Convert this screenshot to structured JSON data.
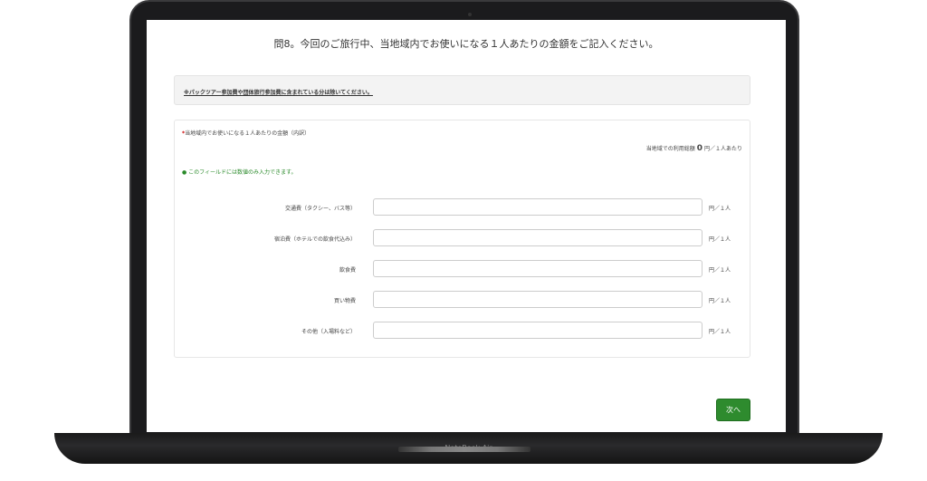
{
  "device": {
    "label": "NoteBook Air"
  },
  "page": {
    "title": "問8。今回のご旅行中、当地域内でお使いになる１人あたりの金額をご記入ください。",
    "notice": "※パックツアー参加費や団体旅行参加費に含まれている分は除いてください。",
    "question_label": "当地域内でお使いになる１人あたりの金額（内訳）",
    "total_label": "当地域での利用総額",
    "total_value": "0",
    "total_unit": "円／１人あたり",
    "hint": "このフィールドには数値のみ入力できます。",
    "fields": [
      {
        "label": "交通費（タクシー、バス等）",
        "value": "",
        "unit": "円／１人"
      },
      {
        "label": "宿泊費（ホテルでの飲食代込み）",
        "value": "",
        "unit": "円／１人"
      },
      {
        "label": "飲食費",
        "value": "",
        "unit": "円／１人"
      },
      {
        "label": "買い物費",
        "value": "",
        "unit": "円／１人"
      },
      {
        "label": "その他（入場料など）",
        "value": "",
        "unit": "円／１人"
      }
    ],
    "next_label": "次へ"
  },
  "colors": {
    "accent": "#2e8b2e",
    "required": "#cc0000"
  }
}
